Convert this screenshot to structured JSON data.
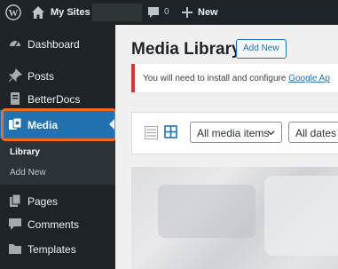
{
  "admin_bar": {
    "my_sites": "My Sites",
    "comment_count": "0",
    "new_label": "New"
  },
  "sidebar": {
    "items": [
      {
        "label": "Dashboard",
        "icon": "dashboard-icon"
      },
      {
        "label": "Posts",
        "icon": "pin-icon"
      },
      {
        "label": "BetterDocs",
        "icon": "docs-icon"
      },
      {
        "label": "Media",
        "icon": "media-icon",
        "active": true
      },
      {
        "label": "Pages",
        "icon": "page-icon"
      },
      {
        "label": "Comments",
        "icon": "comment-icon"
      },
      {
        "label": "Templates",
        "icon": "folder-icon"
      }
    ],
    "submenu": [
      {
        "label": "Library",
        "current": true
      },
      {
        "label": "Add New"
      }
    ]
  },
  "main": {
    "title": "Media Library",
    "add_new_label": "Add New",
    "notice_text": "You will need to install and configure ",
    "notice_link": "Google Ap",
    "filters": {
      "media_items": "All media items",
      "dates": "All dates"
    }
  },
  "colors": {
    "admin_bg": "#1d2327",
    "accent": "#2271b1",
    "highlight": "#f06a1f",
    "notice_border": "#d63638"
  }
}
